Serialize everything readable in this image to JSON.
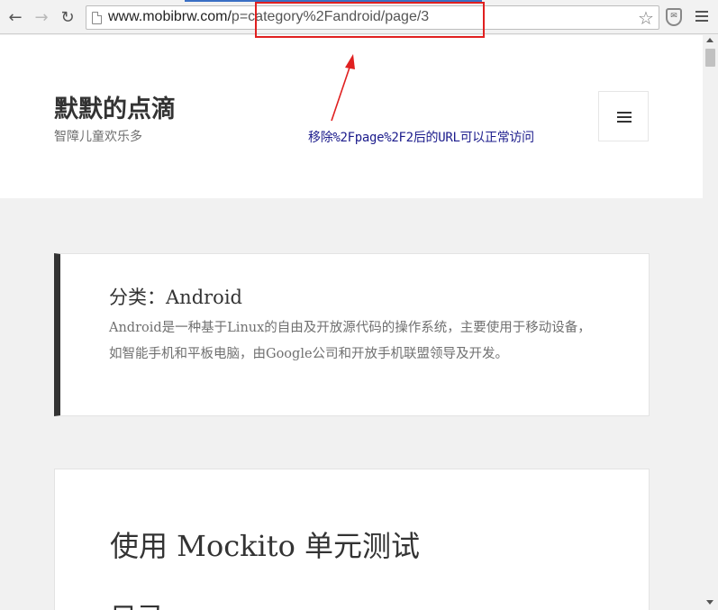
{
  "browser": {
    "url_host": "www.mobibrw.com/",
    "url_path": "p=category%2Fandroid/page/3",
    "icons": {
      "back": "back-arrow-icon",
      "forward": "forward-arrow-icon",
      "reload": "reload-icon",
      "page": "page-icon",
      "bookmark": "star-icon",
      "extension": "shield-extension-icon",
      "menu": "hamburger-menu-icon"
    }
  },
  "site": {
    "title": "默默的点滴",
    "tagline": "智障儿童欢乐多"
  },
  "annotation": {
    "text": "移除%2Fpage%2F2后的URL可以正常访问",
    "color": "#e02020"
  },
  "category": {
    "title": "分类：Android",
    "description": "Android是一种基于Linux的自由及开放源代码的操作系统，主要使用于移动设备，如智能手机和平板电脑，由Google公司和开放手机联盟领导及开发。"
  },
  "article": {
    "title": "使用 Mockito 单元测试",
    "subheading": "目录"
  }
}
